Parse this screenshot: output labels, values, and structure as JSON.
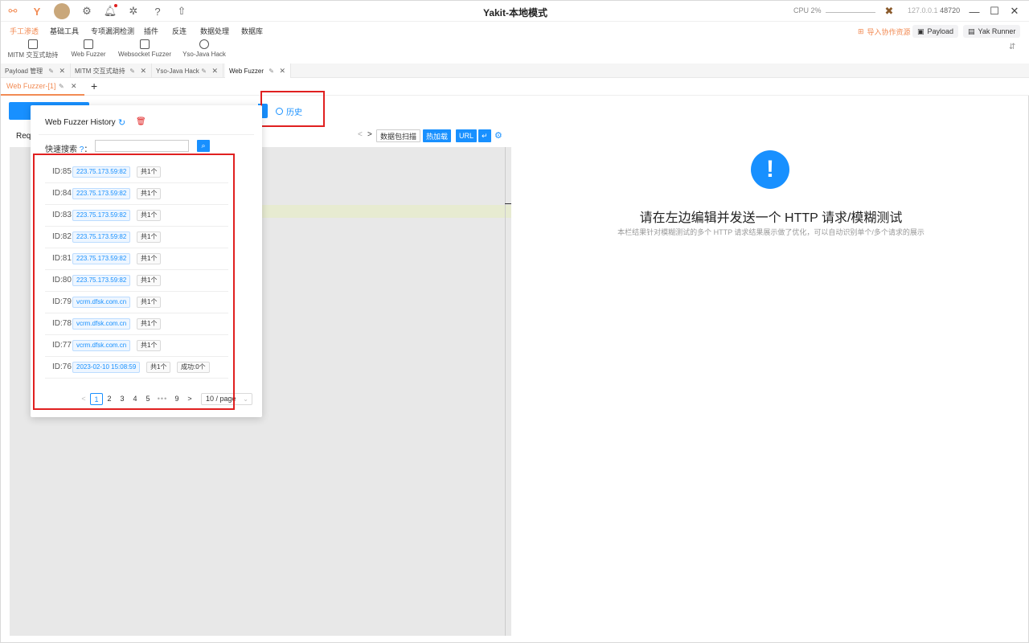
{
  "window": {
    "title": "Yakit-本地模式",
    "cpu_label": "CPU 2%",
    "ip": "127.0.0.1",
    "port": "48720"
  },
  "menu": {
    "items": [
      "手工渗透",
      "基础工具",
      "专项漏洞检测",
      "插件",
      "反连",
      "数据处理",
      "数据库"
    ],
    "sub_items": [
      "MITM 交互式劫持",
      "Web Fuzzer",
      "Websocket Fuzzer",
      "Yso-Java Hack"
    ],
    "import_label": "导入协作资源",
    "payload_label": "Payload",
    "yak_runner_label": "Yak Runner"
  },
  "tabs": {
    "top": [
      "Payload 管理",
      "MITM 交互式劫持",
      "Yso-Java Hack",
      "Web Fuzzer"
    ],
    "sub": "Web Fuzzer-[1]",
    "add": "+"
  },
  "main": {
    "history_label": "历史",
    "request_label": "Requ",
    "toolbar": {
      "scan": "数据包扫描",
      "hotload": "热加载",
      "url": "URL",
      "enter": "↵"
    },
    "empty_title": "请在左边编辑并发送一个 HTTP 请求/模糊测试",
    "empty_subtitle": "本栏结果针对模糊测试的多个 HTTP 请求结果展示做了优化，可以自动识别单个/多个请求的展示"
  },
  "history": {
    "title": "Web Fuzzer History",
    "search_label": "快速搜索",
    "search_help": "?",
    "search_colon": "：",
    "search_value": "",
    "rows": [
      {
        "id": "ID:85",
        "host": "223.75.173.59:82",
        "count": "共1个",
        "status": ""
      },
      {
        "id": "ID:84",
        "host": "223.75.173.59:82",
        "count": "共1个",
        "status": ""
      },
      {
        "id": "ID:83",
        "host": "223.75.173.59:82",
        "count": "共1个",
        "status": ""
      },
      {
        "id": "ID:82",
        "host": "223.75.173.59:82",
        "count": "共1个",
        "status": ""
      },
      {
        "id": "ID:81",
        "host": "223.75.173.59:82",
        "count": "共1个",
        "status": ""
      },
      {
        "id": "ID:80",
        "host": "223.75.173.59:82",
        "count": "共1个",
        "status": ""
      },
      {
        "id": "ID:79",
        "host": "vcrm.dfsk.com.cn",
        "count": "共1个",
        "status": ""
      },
      {
        "id": "ID:78",
        "host": "vcrm.dfsk.com.cn",
        "count": "共1个",
        "status": ""
      },
      {
        "id": "ID:77",
        "host": "vcrm.dfsk.com.cn",
        "count": "共1个",
        "status": ""
      },
      {
        "id": "ID:76",
        "host": "2023-02-10 15:08:59",
        "count": "共1个",
        "status": "成功:0个"
      }
    ],
    "pagination": {
      "prev": "<",
      "pages": [
        "1",
        "2",
        "3",
        "4",
        "5"
      ],
      "dots": "•••",
      "last": "9",
      "next": ">",
      "page_size": "10 / page"
    }
  },
  "colors": {
    "accent": "#f28b54",
    "primary": "#1890ff",
    "highlight_box": "#e02020"
  }
}
